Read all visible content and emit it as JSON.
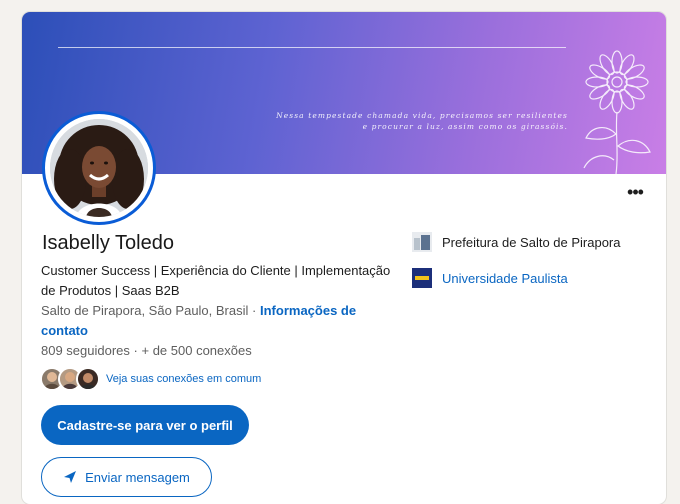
{
  "cover": {
    "quote": "Nessa tempestade chamada vida, precisamos ser resilientes e procurar a luz, assim como os girassóis."
  },
  "profile": {
    "name": "Isabelly Toledo",
    "headline": "Customer Success | Experiência do Cliente | Implementação de Produtos | Saas B2B",
    "location": "Salto de Pirapora, São Paulo, Brasil",
    "separator": "·",
    "contact_link": "Informações de contato",
    "followers": "809 seguidores",
    "stats_separator": "·",
    "connections": "+ de 500 conexões",
    "mutual_link": "Veja suas conexões em comum",
    "more_icon": "•••"
  },
  "actions": {
    "signup_label": "Cadastre-se para ver o perfil",
    "message_label": "Enviar mensagem"
  },
  "organizations": [
    {
      "name": "Prefeitura de Salto de Pirapora"
    },
    {
      "name": "Universidade Paulista"
    }
  ],
  "colors": {
    "accent": "#0a66c2",
    "cover_start": "#2c4fb8",
    "cover_end": "#c97ee6"
  }
}
